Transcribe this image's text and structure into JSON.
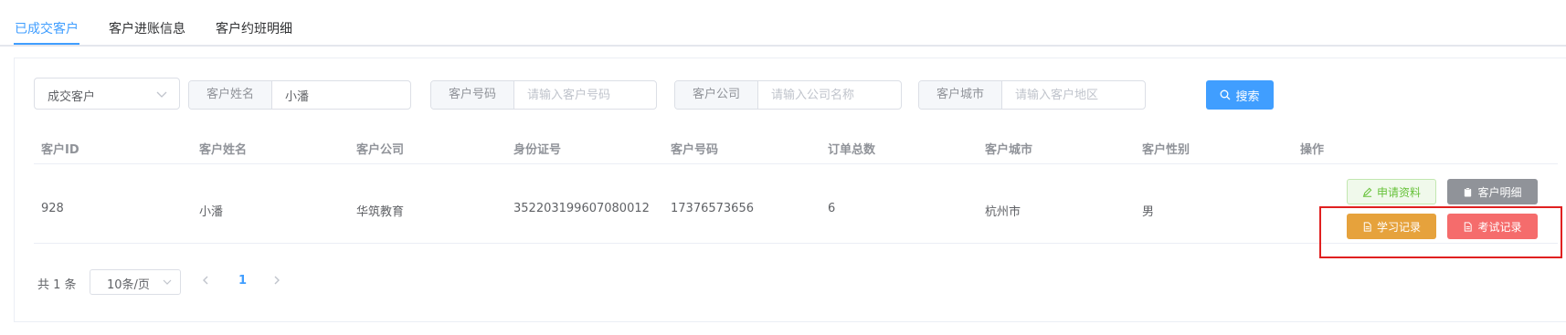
{
  "tabs": [
    "已成交客户",
    "客户进账信息",
    "客户约班明细"
  ],
  "filters": {
    "customer_type_value": "成交客户",
    "name": {
      "label": "客户姓名",
      "value": "小潘"
    },
    "number": {
      "label": "客户号码",
      "placeholder": "请输入客户号码"
    },
    "company": {
      "label": "客户公司",
      "placeholder": "请输入公司名称"
    },
    "city": {
      "label": "客户城市",
      "placeholder": "请输入客户地区"
    },
    "search_label": "搜索"
  },
  "table": {
    "columns": [
      "客户ID",
      "客户姓名",
      "客户公司",
      "身份证号",
      "客户号码",
      "订单总数",
      "客户城市",
      "客户性别",
      "操作"
    ],
    "rows": [
      {
        "id": "928",
        "name": "小潘",
        "company": "华筑教育",
        "id_card": "352203199607080012",
        "phone": "17376573656",
        "orders": "6",
        "city": "杭州市",
        "gender": "男"
      }
    ],
    "actions": {
      "apply": "申请资料",
      "detail": "客户明细",
      "study": "学习记录",
      "exam": "考试记录"
    }
  },
  "pagination": {
    "total_text": "共 1 条",
    "page_size": "10条/页",
    "current_page": "1"
  },
  "colors": {
    "primary": "#409eff",
    "success": "#67c23a",
    "info": "#909399",
    "warning": "#e6a23c",
    "danger": "#f56c6c",
    "highlight": "#e02020"
  }
}
